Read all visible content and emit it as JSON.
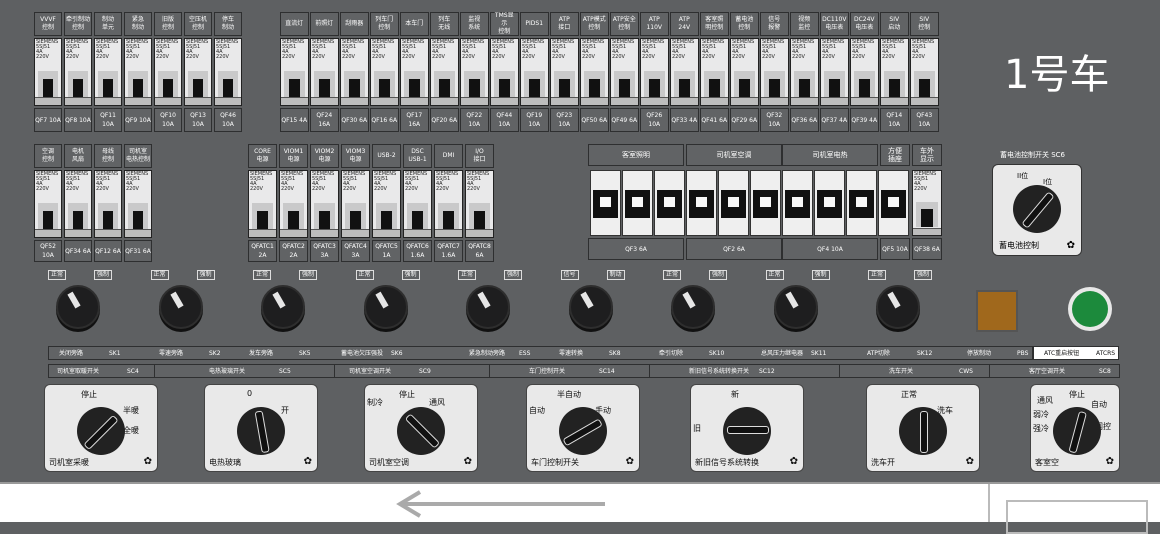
{
  "title": "1号车",
  "row1_left": {
    "labels": [
      "VVVF\n控制",
      "牵引制动\n控制",
      "制动\n单元",
      "紧急\n制动",
      "旧版\n控制",
      "空压机\n控制",
      "停车\n制动"
    ],
    "breakers": [
      "SIEMENS\n5SJ51\n4A\n220V",
      "SIEMENS\n5SJ51\n4A\n220V",
      "SIEMENS\n5SJ51\n4A\n220V",
      "SIEMENS\n5SJ51\n4A\n220V",
      "SIEMENS\n5SJ51\n4A\n220V",
      "SIEMENS\n5SJ51\n4A\n220V",
      "SIEMENS\n5SJ51\n4A\n220V"
    ],
    "ratings": [
      "QF7\n10A",
      "QF8\n10A",
      "QF11\n10A",
      "QF9\n10A",
      "QF10\n10A",
      "QF13\n10A",
      "QF46\n10A"
    ]
  },
  "row1_right": {
    "labels": [
      "直流灯",
      "前照灯",
      "刮雨器",
      "列车门\n控制",
      "本车门",
      "列车\n无线",
      "监视\n系统",
      "TMS显示\n控制",
      "PIDS1",
      "ATP\n接口",
      "ATP模式\n控制",
      "ATP安全\n控制",
      "ATP\n110V",
      "ATP\n24V",
      "客室照\n明控制",
      "蓄电池\n控制",
      "信号\n报警",
      "视频\n监控",
      "DC110V\n电压表",
      "DC24V\n电压表",
      "SIV\n启动",
      "SIV\n控制"
    ],
    "breakers": [
      "SIEMENS\n5SJ51\n4A\n220V",
      "SIEMENS\n5SJ51\n4A\n220V",
      "SIEMENS\n5SJ51\n4A\n220V",
      "SIEMENS\n5SJ51\n4A\n220V",
      "SIEMENS\n5SJ51\n4A\n220V",
      "SIEMENS\n5SJ51\n4A\n220V",
      "SIEMENS\n5SJ51\n4A\n220V",
      "SIEMENS\n5SJ51\n4A\n220V",
      "SIEMENS\n5SJ51\n4A\n220V",
      "SIEMENS\n5SJ51\n4A\n220V",
      "SIEMENS\n5SJ51\n4A\n220V",
      "SIEMENS\n5SJ51\n4A\n220V",
      "SIEMENS\n5SJ51\n4A\n220V",
      "SIEMENS\n5SJ51\n4A\n220V",
      "SIEMENS\n5SJ51\n4A\n220V",
      "SIEMENS\n5SJ51\n4A\n220V",
      "SIEMENS\n5SJ51\n4A\n220V",
      "SIEMENS\n5SJ51\n4A\n220V",
      "SIEMENS\n5SJ51\n4A\n220V",
      "SIEMENS\n5SJ51\n4A\n220V",
      "SIEMENS\n5SJ51\n4A\n220V",
      "SIEMENS\n5SJ51\n4A\n220V"
    ],
    "ratings": [
      "QF15\n4A",
      "QF24\n16A",
      "QF30\n6A",
      "QF16\n6A",
      "QF17\n16A",
      "QF20\n6A",
      "QF22\n10A",
      "QF44\n10A",
      "QF19\n10A",
      "QF23\n10A",
      "QF50\n6A",
      "QF49\n6A",
      "QF26\n10A",
      "QF33\n4A",
      "QF41\n6A",
      "QF29\n6A",
      "QF32\n10A",
      "QF36\n6A",
      "QF37\n4A",
      "QF39\n4A",
      "QF14\n10A",
      "QF43\n10A"
    ]
  },
  "row2_left": {
    "labels": [
      "空调\n控制",
      "电机\n风扇",
      "母线\n控制",
      "司机室\n电热控制"
    ],
    "breakers": [
      "SIEMENS\n5SJ51\n4A\n220V",
      "SIEMENS\n5SJ51\n4A\n220V",
      "SIEMENS\n5SJ51\n4A\n220V",
      "SIEMENS\n5SJ51\n4A\n220V"
    ],
    "ratings": [
      "QF52\n10A",
      "QF34\n6A",
      "QF12\n6A",
      "QF31\n6A"
    ]
  },
  "row2_mid": {
    "labels": [
      "CORE\n电源",
      "VIOM1\n电源",
      "VIOM2\n电源",
      "VIOM3\n电源",
      "USB-2",
      "DSC\nUSB-1",
      "DMI",
      "I/O\n接口"
    ],
    "breakers": [
      "SIEMENS\n5SJ51\n4A\n220V",
      "SIEMENS\n5SJ51\n4A\n220V",
      "SIEMENS\n5SJ51\n4A\n220V",
      "SIEMENS\n5SJ51\n4A\n220V",
      "SIEMENS\n5SJ51\n4A\n220V",
      "SIEMENS\n5SJ51\n4A\n220V",
      "SIEMENS\n5SJ51\n4A\n220V",
      "SIEMENS\n5SJ51\n4A\n220V"
    ],
    "ratings": [
      "QFATC1\n2A",
      "QFATC2\n2A",
      "QFATC3\n3A",
      "QFATC4\n3A",
      "QFATC5\n1A",
      "QFATC6\n1.6A",
      "QFATC7\n1.6A",
      "QFATC8\n6A"
    ]
  },
  "row2_right": {
    "groups": [
      "客室照明",
      "司机室空调",
      "司机室电热",
      "方便\n插座",
      "车外\n显示"
    ],
    "ratings": [
      "QF3\n6A",
      "QF2\n6A",
      "QF4\n10A",
      "QF5\n10A",
      "QF38\n6A"
    ],
    "small_breaker": "SIEMENS\n5SJ51\n4A\n220V"
  },
  "battery": {
    "header": "蓄电池控制开关   SC6",
    "pos_left": "I位",
    "pos_right": "II位",
    "name": "蓄电池控制"
  },
  "knobs": [
    {
      "left": "正常",
      "right": "强制"
    },
    {
      "left": "正常",
      "right": "强制"
    },
    {
      "left": "正常",
      "right": "强制"
    },
    {
      "left": "正常",
      "right": "强制"
    },
    {
      "left": "正常",
      "right": "强制"
    },
    {
      "left": "信号",
      "right": "制动"
    },
    {
      "left": "正常",
      "right": "强制"
    },
    {
      "left": "正常",
      "right": "强制"
    },
    {
      "left": "正常",
      "right": "强制"
    }
  ],
  "bar1": [
    {
      "n": "关闭旁路",
      "c": "SK1"
    },
    {
      "n": "零速旁路",
      "c": "SK2"
    },
    {
      "n": "发车旁路",
      "c": "SK5"
    },
    {
      "n": "蓄电池欠压强投",
      "c": "SK6"
    },
    {
      "n": "紧急制动旁路",
      "c": "ESS"
    },
    {
      "n": "零速转换",
      "c": "SK8"
    },
    {
      "n": "牵引切除",
      "c": "SK10"
    },
    {
      "n": "总风压力继电器",
      "c": "SK11"
    },
    {
      "n": "ATP切除",
      "c": "SK12"
    },
    {
      "n": "停放制动",
      "c": "PBS"
    }
  ],
  "atc": {
    "n": "ATC重启按钮",
    "c": "ATCRS"
  },
  "bar2": [
    {
      "n": "司机室取暖开关",
      "c": "SC4"
    },
    {
      "n": "电热玻璃开关",
      "c": "SC5"
    },
    {
      "n": "司机室空调开关",
      "c": "SC9"
    },
    {
      "n": "车门控制开关",
      "c": "SC14"
    },
    {
      "n": "新旧信号系统转换开关",
      "c": "SC12"
    },
    {
      "n": "洗车开关",
      "c": "CWS"
    },
    {
      "n": "客厅空调开关",
      "c": "SC8"
    }
  ],
  "switches": [
    {
      "name": "司机室采暖",
      "pos": [
        "停止",
        "半暖",
        "全暖"
      ]
    },
    {
      "name": "电热玻璃",
      "pos": [
        "0",
        "开"
      ]
    },
    {
      "name": "司机室空调",
      "pos": [
        "制冷",
        "停止",
        "通风"
      ]
    },
    {
      "name": "车门控制开关",
      "pos": [
        "自动",
        "半自动",
        "手动"
      ]
    },
    {
      "name": "新旧信号系统转换",
      "pos": [
        "旧",
        "新"
      ]
    },
    {
      "name": "洗车开",
      "pos": [
        "正常",
        "洗车"
      ]
    },
    {
      "name": "客室空",
      "pos": [
        "通风",
        "停止",
        "自动",
        "弱冷",
        "强冷",
        "网控"
      ]
    }
  ],
  "colors": {
    "panel": "#5e6062",
    "indicator_amber": "#a0681c",
    "indicator_green": "#1c8a3c"
  },
  "icons": [
    "arrow-left-icon",
    "fan-icon"
  ]
}
